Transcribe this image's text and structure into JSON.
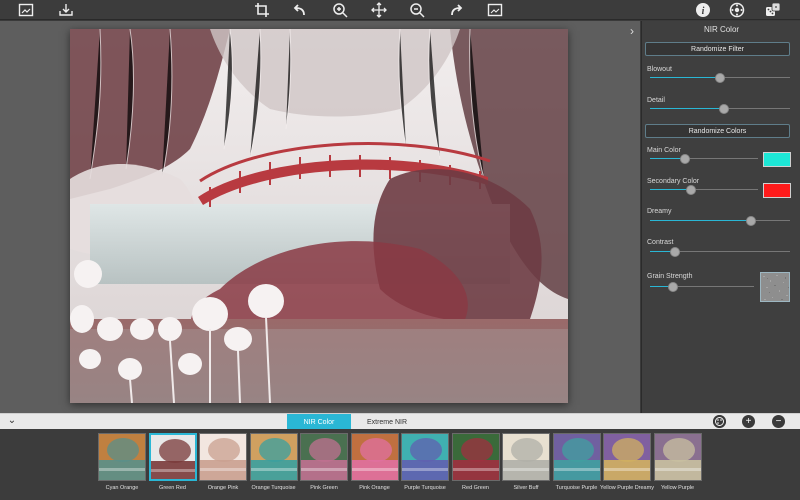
{
  "toolbar": {
    "left_icons": [
      "image-frame-icon",
      "import-icon"
    ],
    "center_icons": [
      "crop-icon",
      "undo-icon",
      "zoom-in-icon",
      "move-icon",
      "zoom-out-icon",
      "redo-icon",
      "fit-image-icon"
    ],
    "right_icons": [
      "info-icon",
      "settings-icon",
      "dice-icon"
    ]
  },
  "panel": {
    "title": "NIR Color",
    "randomize_filter_label": "Randomize Filter",
    "randomize_colors_label": "Randomize Colors",
    "sliders": [
      {
        "label": "Blowout",
        "value": 0.5
      },
      {
        "label": "Detail",
        "value": 0.53
      },
      {
        "label": "Main Color",
        "value": 0.32,
        "swatch": "#1de7d6"
      },
      {
        "label": "Secondary Color",
        "value": 0.38,
        "swatch": "#ff1a1a"
      },
      {
        "label": "Dreamy",
        "value": 0.72
      },
      {
        "label": "Contrast",
        "value": 0.18
      },
      {
        "label": "Grain Strength",
        "value": 0.22
      }
    ]
  },
  "preset_tabs": [
    {
      "label": "NIR Color",
      "active": true
    },
    {
      "label": "Extreme NIR",
      "active": false
    }
  ],
  "bottom_icons": [
    "palette-icon",
    "add-icon",
    "remove-icon"
  ],
  "presets": [
    {
      "name": "Cyan Orange",
      "tint": "#5a8f8a",
      "accent": "#c08040"
    },
    {
      "name": "Green Red",
      "tint": "#7a3a3a",
      "accent": "#e8e8e8",
      "selected": true
    },
    {
      "name": "Orange Pink",
      "tint": "#caa090",
      "accent": "#f2e6e0"
    },
    {
      "name": "Orange Turquoise",
      "tint": "#3aa0a0",
      "accent": "#d0a060"
    },
    {
      "name": "Pink Green",
      "tint": "#c07090",
      "accent": "#4a7050"
    },
    {
      "name": "Pink Orange",
      "tint": "#e070a0",
      "accent": "#c07040"
    },
    {
      "name": "Purple Turquoise",
      "tint": "#6060b0",
      "accent": "#40b0b0"
    },
    {
      "name": "Red Green",
      "tint": "#a03040",
      "accent": "#3a6a3a"
    },
    {
      "name": "Silver Buff",
      "tint": "#b0b0a8",
      "accent": "#e8e0d0"
    },
    {
      "name": "Turquoise Purple",
      "tint": "#40a0a0",
      "accent": "#7060a0"
    },
    {
      "name": "Yellow Purple Dreamy",
      "tint": "#d0b060",
      "accent": "#8060a0"
    },
    {
      "name": "Yellow Purple",
      "tint": "#c8c0a0",
      "accent": "#8a7090"
    }
  ],
  "colors": {
    "accent": "#2ab7d5",
    "panel_bg": "#3f3f3f",
    "canvas_bg": "#5e5e5e"
  }
}
